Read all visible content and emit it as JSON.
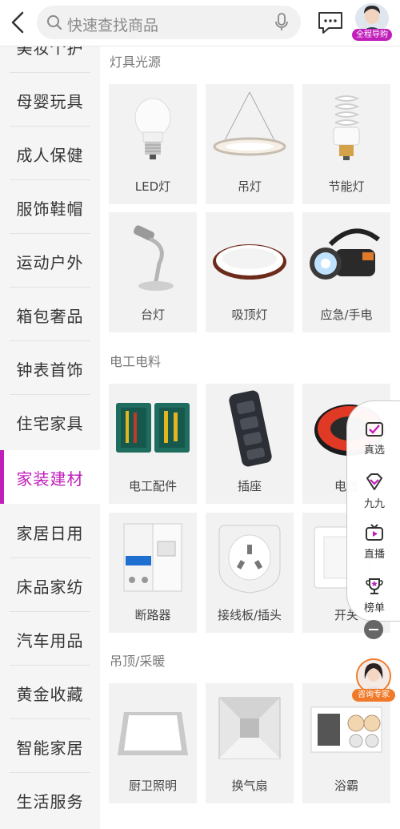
{
  "header": {
    "search_placeholder": "快速查找商品",
    "guide_badge": "全程导购"
  },
  "sidebar": {
    "items": [
      {
        "label": "美妆个护"
      },
      {
        "label": "母婴玩具"
      },
      {
        "label": "成人保健"
      },
      {
        "label": "服饰鞋帽"
      },
      {
        "label": "运动户外"
      },
      {
        "label": "箱包奢品"
      },
      {
        "label": "钟表首饰"
      },
      {
        "label": "住宅家具"
      },
      {
        "label": "家装建材",
        "active": true
      },
      {
        "label": "家居日用"
      },
      {
        "label": "床品家纺"
      },
      {
        "label": "汽车用品"
      },
      {
        "label": "黄金收藏"
      },
      {
        "label": "智能家居"
      },
      {
        "label": "生活服务"
      }
    ]
  },
  "main": {
    "sections": [
      {
        "title": "灯具光源",
        "items": [
          {
            "label": "LED灯",
            "icon": "led-bulb"
          },
          {
            "label": "吊灯",
            "icon": "pendant-lamp"
          },
          {
            "label": "节能灯",
            "icon": "energy-saving-bulb"
          },
          {
            "label": "台灯",
            "icon": "desk-lamp"
          },
          {
            "label": "吸顶灯",
            "icon": "ceiling-lamp"
          },
          {
            "label": "应急/手电",
            "icon": "flashlight"
          }
        ]
      },
      {
        "title": "电工电料",
        "items": [
          {
            "label": "电工配件",
            "icon": "toolkit"
          },
          {
            "label": "插座",
            "icon": "power-strip"
          },
          {
            "label": "电线",
            "icon": "wire-coil"
          },
          {
            "label": "断路器",
            "icon": "circuit-breaker"
          },
          {
            "label": "接线板/插头",
            "icon": "plug"
          },
          {
            "label": "开关",
            "icon": "wall-switch"
          }
        ]
      },
      {
        "title": "吊顶/采暖",
        "items": [
          {
            "label": "厨卫照明",
            "icon": "panel-light"
          },
          {
            "label": "换气扇",
            "icon": "exhaust-fan"
          },
          {
            "label": "浴霸",
            "icon": "bath-heater"
          }
        ]
      }
    ]
  },
  "float_panel": {
    "items": [
      {
        "label": "真选"
      },
      {
        "label": "九九"
      },
      {
        "label": "直播"
      },
      {
        "label": "榜单"
      }
    ]
  },
  "expert": {
    "badge": "咨询专家"
  },
  "colors": {
    "accent": "#c01fba",
    "expert": "#f07a2a"
  }
}
